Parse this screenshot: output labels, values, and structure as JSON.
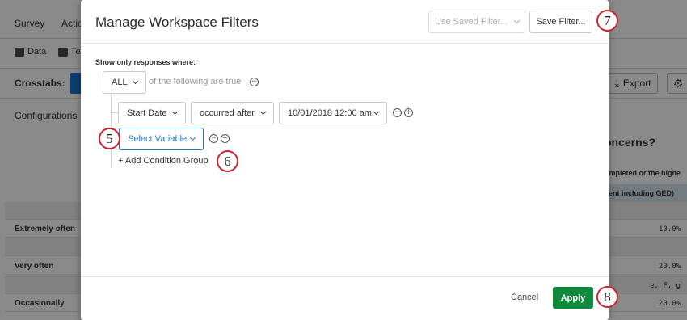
{
  "background": {
    "tabs": [
      "Survey",
      "Actio"
    ],
    "subtabs": [
      "Data",
      "Te"
    ],
    "crosstabs_label": "Crosstabs:",
    "export_label": "Export",
    "configurations_label": "Configurations",
    "heading_fragment": "oncerns?",
    "col_header_1": "ompleted or the highe",
    "col_header_2": "ilent including GED)",
    "rows": [
      {
        "label": "Extremely often",
        "value": "10.0%"
      },
      {
        "label": "",
        "value": ""
      },
      {
        "label": "Very often",
        "value": "20.0%"
      },
      {
        "label": "",
        "value": "e, F, g"
      },
      {
        "label": "Occasionally",
        "value": "20.0%"
      }
    ]
  },
  "modal": {
    "title": "Manage Workspace Filters",
    "use_saved_filter": "Use Saved Filter...",
    "save_filter": "Save Filter...",
    "show_only": "Show only responses where:",
    "conjunction": "ALL",
    "following_text": "of the following are true",
    "condition": {
      "field": "Start Date",
      "operator": "occurred after",
      "value": "10/01/2018 12:00 am"
    },
    "select_variable": "Select Variable",
    "add_condition_group": "+ Add Condition Group",
    "cancel": "Cancel",
    "apply": "Apply"
  },
  "markers": [
    "5",
    "6",
    "7",
    "8"
  ],
  "colors": {
    "apply_green": "#0f8a3c",
    "select_blue": "#1f78c8",
    "marker_red": "#c8262c"
  }
}
